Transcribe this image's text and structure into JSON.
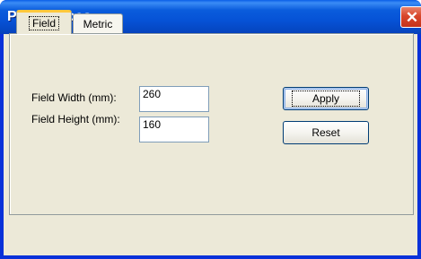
{
  "window": {
    "title": "Preferences",
    "close_glyph": "✕"
  },
  "tabs": [
    {
      "label": "Field",
      "active": true
    },
    {
      "label": "Metric",
      "active": false
    }
  ],
  "form": {
    "width_label": "Field Width (mm):",
    "width_value": "260",
    "height_label": "Field Height (mm):",
    "height_value": "160"
  },
  "buttons": {
    "apply": "Apply",
    "reset": "Reset"
  },
  "colors": {
    "titlebar": "#0652d6",
    "client": "#ece9d8",
    "close": "#d8462a"
  }
}
